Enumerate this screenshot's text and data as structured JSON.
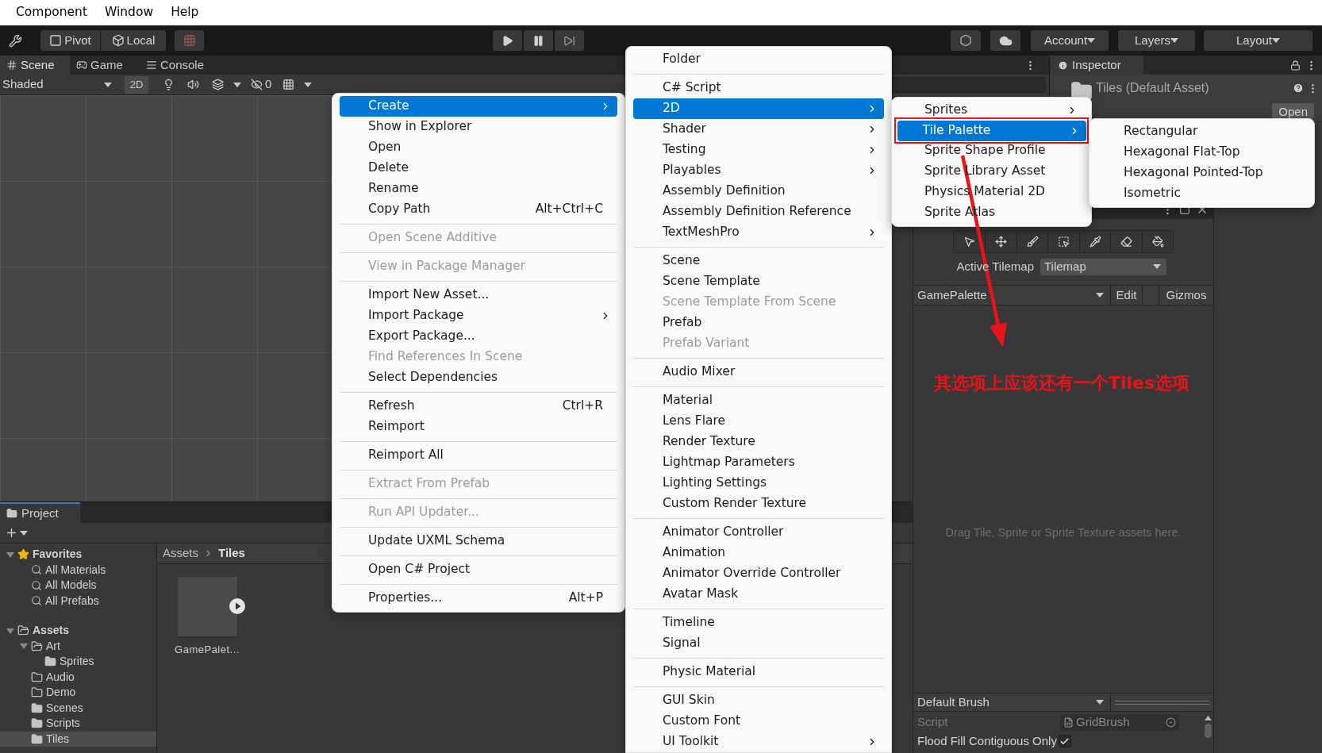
{
  "menubar": [
    "Component",
    "Window",
    "Help"
  ],
  "toolbar": {
    "pivot": "Pivot",
    "local": "Local",
    "account": "Account",
    "layers": "Layers",
    "layout": "Layout"
  },
  "scene_tabs": [
    {
      "label": "Scene",
      "selected": true
    },
    {
      "label": "Game",
      "selected": false
    },
    {
      "label": "Console",
      "selected": false
    }
  ],
  "scene_toolbar": {
    "shading": "Shaded",
    "mode_2d": "2D",
    "hidden_count": "0"
  },
  "project": {
    "tab": "Project",
    "tree": [
      {
        "label": "Favorites",
        "kind": "star",
        "expanded": true,
        "selected": false,
        "children": [
          {
            "label": "All Materials",
            "kind": "search",
            "selected": false
          },
          {
            "label": "All Models",
            "kind": "search",
            "selected": false
          },
          {
            "label": "All Prefabs",
            "kind": "search",
            "selected": false
          }
        ]
      },
      {
        "label": "Assets",
        "kind": "folder",
        "expanded": true,
        "selected": false,
        "children": [
          {
            "label": "Art",
            "kind": "folder",
            "expanded": true,
            "selected": false,
            "children": [
              {
                "label": "Sprites",
                "kind": "folder",
                "selected": false
              }
            ]
          },
          {
            "label": "Audio",
            "kind": "empty-folder",
            "selected": false
          },
          {
            "label": "Demo",
            "kind": "empty-folder",
            "selected": false
          },
          {
            "label": "Scenes",
            "kind": "folder",
            "selected": false
          },
          {
            "label": "Scripts",
            "kind": "folder",
            "selected": false
          },
          {
            "label": "Tiles",
            "kind": "folder",
            "selected": true
          }
        ]
      }
    ],
    "breadcrumb": [
      "Assets",
      "Tiles"
    ],
    "assets": [
      {
        "name": "GamePalet..."
      }
    ]
  },
  "inspector": {
    "tab": "Inspector",
    "title": "Tiles (Default Asset)",
    "open_button": "Open"
  },
  "tile_palette": {
    "active_tilemap_label": "Active Tilemap",
    "active_tilemap": "Tilemap",
    "palette": "GamePalette",
    "edit": "Edit",
    "gizmos": "Gizmos",
    "drop_hint": "Drag Tile, Sprite or Sprite Texture assets here.",
    "brush": "Default Brush",
    "fields": [
      {
        "label": "Script",
        "kind": "object",
        "value": "GridBrush"
      },
      {
        "label": "Flood Fill Contiguous Only",
        "kind": "checkbox",
        "checked": true
      }
    ]
  },
  "context_menus": [
    {
      "groups": [
        [
          {
            "label": "Create",
            "selected": true,
            "disabled": false,
            "submenu": true
          },
          {
            "label": "Show in Explorer",
            "selected": false,
            "disabled": false,
            "submenu": false
          },
          {
            "label": "Open",
            "selected": false,
            "disabled": false,
            "submenu": false
          },
          {
            "label": "Delete",
            "selected": false,
            "disabled": false,
            "submenu": false
          },
          {
            "label": "Rename",
            "selected": false,
            "disabled": false,
            "submenu": false
          },
          {
            "label": "Copy Path",
            "shortcut": "Alt+Ctrl+C",
            "selected": false,
            "disabled": false,
            "submenu": false
          }
        ],
        [
          {
            "label": "Open Scene Additive",
            "selected": false,
            "disabled": true,
            "submenu": false
          }
        ],
        [
          {
            "label": "View in Package Manager",
            "selected": false,
            "disabled": true,
            "submenu": false
          }
        ],
        [
          {
            "label": "Import New Asset...",
            "selected": false,
            "disabled": false,
            "submenu": false
          },
          {
            "label": "Import Package",
            "selected": false,
            "disabled": false,
            "submenu": true
          },
          {
            "label": "Export Package...",
            "selected": false,
            "disabled": false,
            "submenu": false
          },
          {
            "label": "Find References In Scene",
            "selected": false,
            "disabled": true,
            "submenu": false
          },
          {
            "label": "Select Dependencies",
            "selected": false,
            "disabled": false,
            "submenu": false
          }
        ],
        [
          {
            "label": "Refresh",
            "shortcut": "Ctrl+R",
            "selected": false,
            "disabled": false,
            "submenu": false
          },
          {
            "label": "Reimport",
            "selected": false,
            "disabled": false,
            "submenu": false
          }
        ],
        [
          {
            "label": "Reimport All",
            "selected": false,
            "disabled": false,
            "submenu": false
          }
        ],
        [
          {
            "label": "Extract From Prefab",
            "selected": false,
            "disabled": true,
            "submenu": false
          }
        ],
        [
          {
            "label": "Run API Updater...",
            "selected": false,
            "disabled": true,
            "submenu": false
          }
        ],
        [
          {
            "label": "Update UXML Schema",
            "selected": false,
            "disabled": false,
            "submenu": false
          }
        ],
        [
          {
            "label": "Open C# Project",
            "selected": false,
            "disabled": false,
            "submenu": false
          }
        ],
        [
          {
            "label": "Properties...",
            "shortcut": "Alt+P",
            "selected": false,
            "disabled": false,
            "submenu": false
          }
        ]
      ]
    },
    {
      "groups": [
        [
          {
            "label": "Folder",
            "selected": false,
            "disabled": false,
            "submenu": false
          }
        ],
        [
          {
            "label": "C# Script",
            "selected": false,
            "disabled": false,
            "submenu": false
          },
          {
            "label": "2D",
            "selected": true,
            "disabled": false,
            "submenu": true
          },
          {
            "label": "Shader",
            "selected": false,
            "disabled": false,
            "submenu": true
          },
          {
            "label": "Testing",
            "selected": false,
            "disabled": false,
            "submenu": true
          },
          {
            "label": "Playables",
            "selected": false,
            "disabled": false,
            "submenu": true
          },
          {
            "label": "Assembly Definition",
            "selected": false,
            "disabled": false,
            "submenu": false
          },
          {
            "label": "Assembly Definition Reference",
            "selected": false,
            "disabled": false,
            "submenu": false
          },
          {
            "label": "TextMeshPro",
            "selected": false,
            "disabled": false,
            "submenu": true
          }
        ],
        [
          {
            "label": "Scene",
            "selected": false,
            "disabled": false,
            "submenu": false
          },
          {
            "label": "Scene Template",
            "selected": false,
            "disabled": false,
            "submenu": false
          },
          {
            "label": "Scene Template From Scene",
            "selected": false,
            "disabled": true,
            "submenu": false
          },
          {
            "label": "Prefab",
            "selected": false,
            "disabled": false,
            "submenu": false
          },
          {
            "label": "Prefab Variant",
            "selected": false,
            "disabled": true,
            "submenu": false
          }
        ],
        [
          {
            "label": "Audio Mixer",
            "selected": false,
            "disabled": false,
            "submenu": false
          }
        ],
        [
          {
            "label": "Material",
            "selected": false,
            "disabled": false,
            "submenu": false
          },
          {
            "label": "Lens Flare",
            "selected": false,
            "disabled": false,
            "submenu": false
          },
          {
            "label": "Render Texture",
            "selected": false,
            "disabled": false,
            "submenu": false
          },
          {
            "label": "Lightmap Parameters",
            "selected": false,
            "disabled": false,
            "submenu": false
          },
          {
            "label": "Lighting Settings",
            "selected": false,
            "disabled": false,
            "submenu": false
          },
          {
            "label": "Custom Render Texture",
            "selected": false,
            "disabled": false,
            "submenu": false
          }
        ],
        [
          {
            "label": "Animator Controller",
            "selected": false,
            "disabled": false,
            "submenu": false
          },
          {
            "label": "Animation",
            "selected": false,
            "disabled": false,
            "submenu": false
          },
          {
            "label": "Animator Override Controller",
            "selected": false,
            "disabled": false,
            "submenu": false
          },
          {
            "label": "Avatar Mask",
            "selected": false,
            "disabled": false,
            "submenu": false
          }
        ],
        [
          {
            "label": "Timeline",
            "selected": false,
            "disabled": false,
            "submenu": false
          },
          {
            "label": "Signal",
            "selected": false,
            "disabled": false,
            "submenu": false
          }
        ],
        [
          {
            "label": "Physic Material",
            "selected": false,
            "disabled": false,
            "submenu": false
          }
        ],
        [
          {
            "label": "GUI Skin",
            "selected": false,
            "disabled": false,
            "submenu": false
          },
          {
            "label": "Custom Font",
            "selected": false,
            "disabled": false,
            "submenu": false
          },
          {
            "label": "UI Toolkit",
            "selected": false,
            "disabled": false,
            "submenu": true
          }
        ]
      ]
    },
    {
      "groups": [
        [
          {
            "label": "Sprites",
            "selected": false,
            "disabled": false,
            "submenu": true,
            "outlined": false
          },
          {
            "label": "Tile Palette",
            "selected": true,
            "disabled": false,
            "submenu": true,
            "outlined": true
          },
          {
            "label": "Sprite Shape Profile",
            "selected": false,
            "disabled": false,
            "submenu": false,
            "outlined": false
          },
          {
            "label": "Sprite Library Asset",
            "selected": false,
            "disabled": false,
            "submenu": false,
            "outlined": false
          },
          {
            "label": "Physics Material 2D",
            "selected": false,
            "disabled": false,
            "submenu": false,
            "outlined": false
          },
          {
            "label": "Sprite Atlas",
            "selected": false,
            "disabled": false,
            "submenu": false,
            "outlined": false
          }
        ]
      ]
    },
    {
      "groups": [
        [
          {
            "label": "Rectangular",
            "selected": false,
            "disabled": false,
            "submenu": false
          },
          {
            "label": "Hexagonal Flat-Top",
            "selected": false,
            "disabled": false,
            "submenu": false
          },
          {
            "label": "Hexagonal Pointed-Top",
            "selected": false,
            "disabled": false,
            "submenu": false
          },
          {
            "label": "Isometric",
            "selected": false,
            "disabled": false,
            "submenu": false
          }
        ]
      ]
    }
  ],
  "annotation": {
    "text": "其选项上应该还有一个Tiles选项"
  }
}
